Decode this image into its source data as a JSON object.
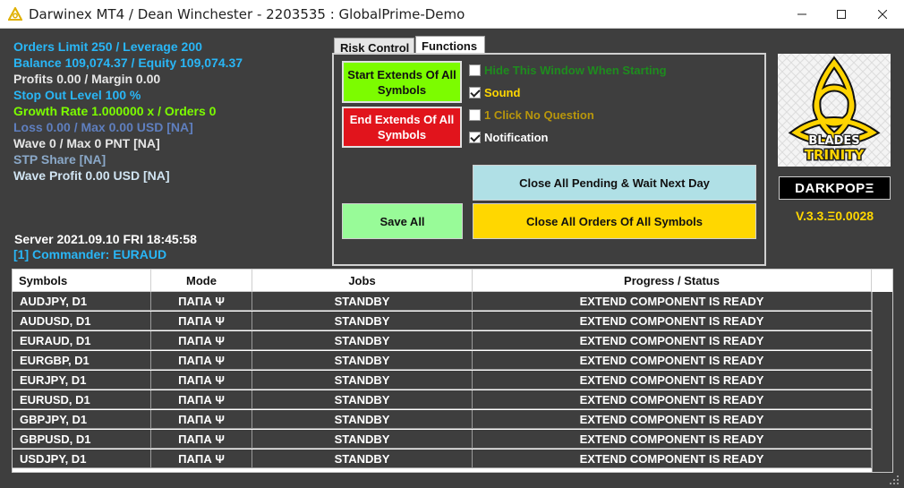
{
  "window": {
    "title": "Darwinex MT4 / Dean Winchester - 2203535 : GlobalPrime-Demo",
    "controls": [
      "minimize",
      "maximize",
      "close"
    ]
  },
  "stats": [
    {
      "text": "Orders Limit 250 / Leverage 200",
      "color": "#29b6f6"
    },
    {
      "text": "Balance 109,074.37 / Equity 109,074.37",
      "color": "#29b6f6"
    },
    {
      "text": "Profits 0.00 / Margin 0.00",
      "color": "#e6e6e6"
    },
    {
      "text": "Stop Out Level 100 %",
      "color": "#29b6f6"
    },
    {
      "text": "Growth Rate 1.000000 x / Orders 0",
      "color": "#7cfc00"
    },
    {
      "text": "Loss 0.00 / Max 0.00 USD [NA]",
      "color": "#5f7fbf"
    },
    {
      "text": "Wave 0 / Max 0 PNT [NA]",
      "color": "#e6e6e6"
    },
    {
      "text": "STP Share [NA]",
      "color": "#8aa8c8"
    },
    {
      "text": "Wave Profit 0.00 USD [NA]",
      "color": "#d0e4f2"
    }
  ],
  "server": {
    "time": "Server 2021.09.10 FRI 18:45:58",
    "commander": "[1] Commander: EURAUD"
  },
  "tabs": {
    "risk_control": "Risk Control",
    "functions": "Functions"
  },
  "functions": {
    "start_extends": "Start Extends Of All Symbols",
    "end_extends": "End Extends Of All Symbols",
    "save_all": "Save All",
    "close_pending": "Close All Pending & Wait Next Day",
    "close_all_orders": "Close All Orders Of All Symbols",
    "options": [
      {
        "label": "Hide This Window When Starting",
        "checked": false,
        "color": "#1e8c1e"
      },
      {
        "label": "Sound",
        "checked": true,
        "color": "#ffd700"
      },
      {
        "label": "1 Click No Question",
        "checked": false,
        "color": "#b8960c"
      },
      {
        "label": "Notification",
        "checked": true,
        "color": "#ffffff"
      }
    ]
  },
  "branding": {
    "logo_text_1": "BLADES",
    "logo_text_2": "TRINITY",
    "name": "DARKPOPΞ",
    "version": "V.3.3.Ξ0.0028"
  },
  "table": {
    "columns": [
      "Symbols",
      "Mode",
      "Jobs",
      "Progress / Status"
    ],
    "rows": [
      {
        "symbol": "AUDJPY, D1",
        "mode": "ΠΑΠΑ Ψ",
        "jobs": "STANDBY",
        "status": "EXTEND COMPONENT IS READY"
      },
      {
        "symbol": "AUDUSD, D1",
        "mode": "ΠΑΠΑ Ψ",
        "jobs": "STANDBY",
        "status": "EXTEND COMPONENT IS READY"
      },
      {
        "symbol": "EURAUD, D1",
        "mode": "ΠΑΠΑ Ψ",
        "jobs": "STANDBY",
        "status": "EXTEND COMPONENT IS READY"
      },
      {
        "symbol": "EURGBP, D1",
        "mode": "ΠΑΠΑ Ψ",
        "jobs": "STANDBY",
        "status": "EXTEND COMPONENT IS READY"
      },
      {
        "symbol": "EURJPY, D1",
        "mode": "ΠΑΠΑ Ψ",
        "jobs": "STANDBY",
        "status": "EXTEND COMPONENT IS READY"
      },
      {
        "symbol": "EURUSD, D1",
        "mode": "ΠΑΠΑ Ψ",
        "jobs": "STANDBY",
        "status": "EXTEND COMPONENT IS READY"
      },
      {
        "symbol": "GBPJPY, D1",
        "mode": "ΠΑΠΑ Ψ",
        "jobs": "STANDBY",
        "status": "EXTEND COMPONENT IS READY"
      },
      {
        "symbol": "GBPUSD, D1",
        "mode": "ΠΑΠΑ Ψ",
        "jobs": "STANDBY",
        "status": "EXTEND COMPONENT IS READY"
      },
      {
        "symbol": "USDJPY, D1",
        "mode": "ΠΑΠΑ Ψ",
        "jobs": "STANDBY",
        "status": "EXTEND COMPONENT IS READY"
      }
    ]
  }
}
